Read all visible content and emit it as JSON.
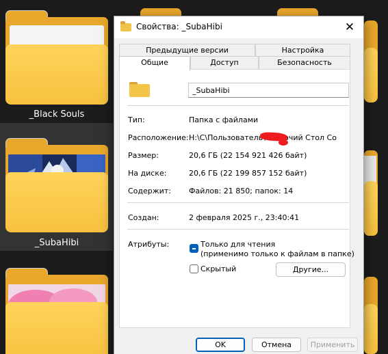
{
  "desktop": {
    "folders": [
      {
        "label": "_Black Souls"
      },
      {
        "label": "_SubaHibi"
      }
    ]
  },
  "dialog": {
    "title": "Свойства: _SubaHibi",
    "close_glyph": "✕",
    "tabs_row1": [
      "Предыдущие версии",
      "Настройка"
    ],
    "tabs_row2": [
      "Общие",
      "Доступ",
      "Безопасность"
    ],
    "name_value": "_SubaHibi",
    "fields": {
      "type_label": "Тип:",
      "type_value": "Папка с файлами",
      "location_label": "Расположение:",
      "location_value": "Н:\\С\\Пользователь\\        \\Рабочий Стол Со",
      "size_label": "Размер:",
      "size_value": "20,6 ГБ (22 154 921 426 байт)",
      "disk_label": "На диске:",
      "disk_value": "20,6 ГБ (22 199 857 152 байт)",
      "contains_label": "Содержит:",
      "contains_value": "Файлов: 21 850; папок: 14",
      "created_label": "Создан:",
      "created_value": "2 февраля 2025 г., 23:40:41",
      "attributes_label": "Атрибуты:"
    },
    "attributes": {
      "readonly_line1": "Только для чтения",
      "readonly_line2": "(применимо только к файлам в папке)",
      "readonly_state": "indeterminate",
      "hidden_label": "Скрытый",
      "hidden_checked": false,
      "other_button": "Другие..."
    },
    "buttons": {
      "ok": "OK",
      "cancel": "Отмена",
      "apply": "Применить"
    }
  },
  "colors": {
    "folder": "#f7c13f",
    "accent": "#005fb8",
    "redaction": "#ee1c1c"
  }
}
